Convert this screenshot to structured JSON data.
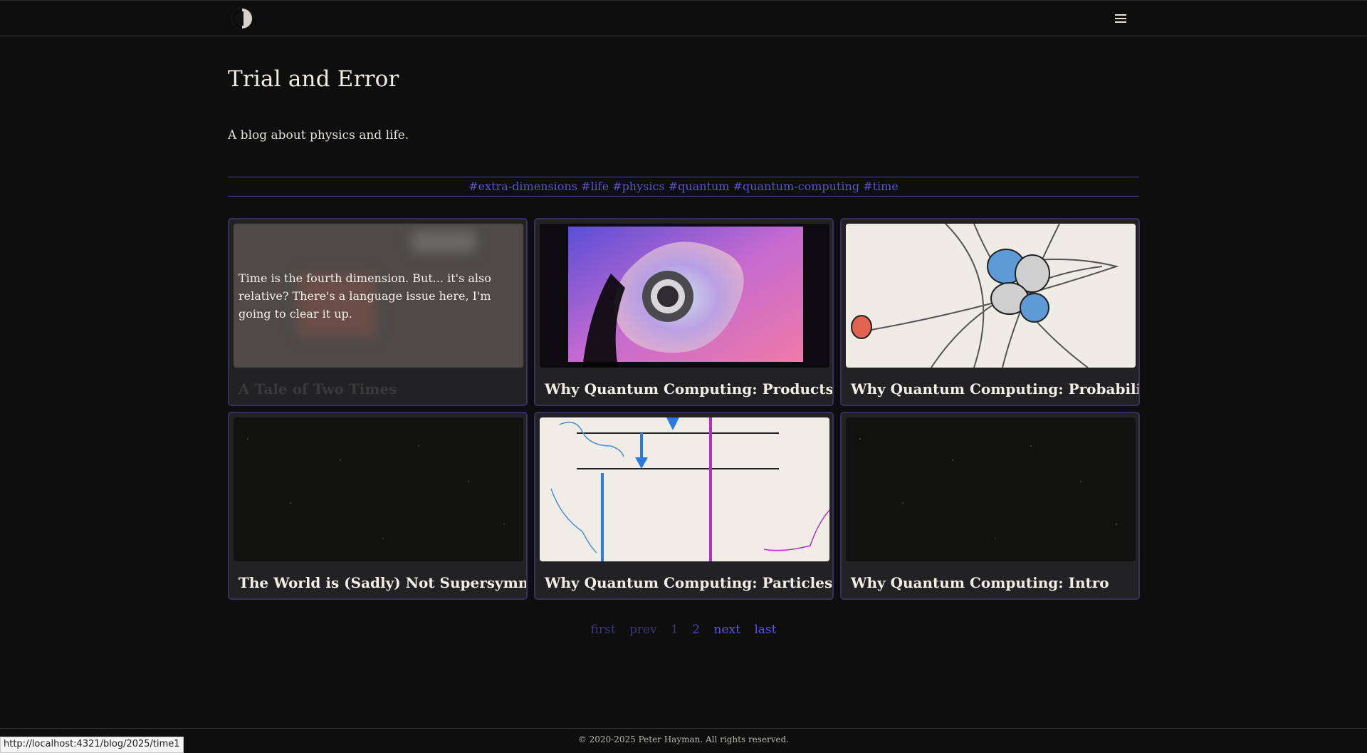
{
  "header": {
    "theme_toggle_icon": "half-moon-icon",
    "menu_icon": "hamburger-menu-icon"
  },
  "page": {
    "title": "Trial and Error",
    "subtitle": "A blog about physics and life."
  },
  "tags": [
    "#extra-dimensions",
    "#life",
    "#physics",
    "#quantum",
    "#quantum-computing",
    "#time"
  ],
  "posts": [
    {
      "title": "A Tale of Two Times",
      "excerpt": "Time is the fourth dimension. But... it's also relative? There's a language issue here, I'm going to clear it up.",
      "hovered": true
    },
    {
      "title": "Why Quantum Computing: Products"
    },
    {
      "title": "Why Quantum Computing: Probabilities"
    },
    {
      "title": "The World is (Sadly) Not Supersymmetric"
    },
    {
      "title": "Why Quantum Computing: Particles"
    },
    {
      "title": "Why Quantum Computing: Intro"
    }
  ],
  "pagination": {
    "first": "first",
    "prev": "prev",
    "page1": "1",
    "page2": "2",
    "next": "next",
    "last": "last",
    "current_page": 2
  },
  "footer": {
    "copyright": "© 2020-2025 Peter Hayman. All rights reserved."
  },
  "status_bar": {
    "url": "http://localhost:4321/blog/2025/time1"
  },
  "colors": {
    "background": "#0e0e0f",
    "accent": "#5b54e0",
    "card_bg": "#222224"
  }
}
